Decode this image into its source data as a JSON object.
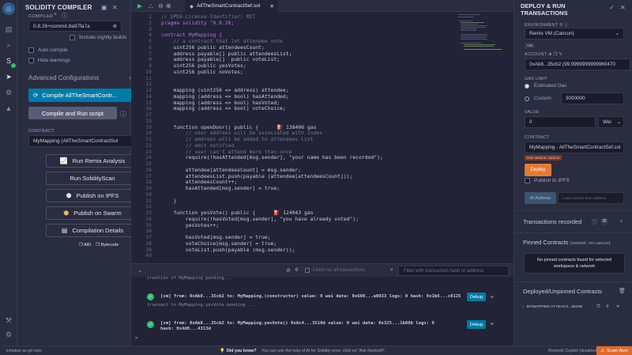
{
  "left_panel": {
    "title": "SOLIDITY COMPILER",
    "compiler_label": "COMPILER",
    "compiler_version": "0.8.26+commit.8a97fa7a",
    "include_nightly": "Include nightly builds",
    "auto_compile": "Auto compile",
    "hide_warnings": "Hide warnings",
    "advanced": "Advanced Configurations",
    "compile_button": "Compile AllTheSmartContr...",
    "compile_run_button": "Compile and Run script",
    "contract_label": "CONTRACT",
    "contract_value": "MyMapping (AllTheSmartContractSol",
    "tools": [
      {
        "label": "Run Remix Analysis"
      },
      {
        "label": "Run SolidityScan"
      },
      {
        "label": "Publish on IPFS"
      },
      {
        "label": "Publish on Swarm"
      },
      {
        "label": "Compilation Details"
      }
    ],
    "abi": "ABI",
    "bytecode": "Bytecode"
  },
  "editor": {
    "tab_name": "AllTheSmartContractSef.sol",
    "lines": [
      {
        "n": "1",
        "t": "// SPDX-License-Identifier: MIT",
        "c": "cm"
      },
      {
        "n": "2",
        "t": "pragma solidity ^0.8.20;",
        "c": "kw"
      },
      {
        "n": "3",
        "t": "",
        "c": ""
      },
      {
        "n": "4",
        "t": "contract MyMapping {",
        "c": "kw"
      },
      {
        "n": "5",
        "t": "    // a contract that let attendee vote",
        "c": "cm"
      },
      {
        "n": "6",
        "t": "    uint256 public attendeesCount;",
        "c": ""
      },
      {
        "n": "7",
        "t": "    address payable[] public attendeesList;",
        "c": ""
      },
      {
        "n": "8",
        "t": "    address payable[]  public voteList;",
        "c": ""
      },
      {
        "n": "9",
        "t": "    uint256 public yesVotes;",
        "c": ""
      },
      {
        "n": "10",
        "t": "    uint256 public noVotes;",
        "c": ""
      },
      {
        "n": "11",
        "t": "",
        "c": ""
      },
      {
        "n": "12",
        "t": "",
        "c": ""
      },
      {
        "n": "13",
        "t": "    mapping (uint256 => address) attendee;",
        "c": ""
      },
      {
        "n": "14",
        "t": "    mapping (address => bool) hasAttended;",
        "c": ""
      },
      {
        "n": "15",
        "t": "    mapping (address => bool) hasVoted;",
        "c": ""
      },
      {
        "n": "16",
        "t": "    mapping (address => bool) voteChoice;",
        "c": ""
      },
      {
        "n": "17",
        "t": "",
        "c": ""
      },
      {
        "n": "18",
        "t": "",
        "c": ""
      },
      {
        "n": "19",
        "t": "    function openDoor() public {      ⛽ 138406 gas",
        "c": ""
      },
      {
        "n": "20",
        "t": "        // user address will be associated with index",
        "c": "cm"
      },
      {
        "n": "21",
        "t": "        // address will be added to attendees list",
        "c": "cm"
      },
      {
        "n": "22",
        "t": "        // emit notified",
        "c": "cm"
      },
      {
        "n": "23",
        "t": "        // user can't attend more than once",
        "c": "cm"
      },
      {
        "n": "24",
        "t": "        require(!hasAttended[msg.sender], \"your name has been recorded\");",
        "c": ""
      },
      {
        "n": "25",
        "t": "",
        "c": ""
      },
      {
        "n": "26",
        "t": "        attendee[attendeesCount] = msg.sender;",
        "c": ""
      },
      {
        "n": "27",
        "t": "        attendeesList.push(payable (attendee[attendeesCount]));",
        "c": ""
      },
      {
        "n": "28",
        "t": "        attendeesCount++;",
        "c": ""
      },
      {
        "n": "29",
        "t": "        hasAttended[msg.sender] = true;",
        "c": ""
      },
      {
        "n": "30",
        "t": "",
        "c": ""
      },
      {
        "n": "31",
        "t": "    }",
        "c": ""
      },
      {
        "n": "32",
        "t": "",
        "c": ""
      },
      {
        "n": "33",
        "t": "    function yesVote() public {      ⛽ 124043 gas",
        "c": ""
      },
      {
        "n": "34",
        "t": "        require(!hasVoted[msg.sender], \"you have already voted\");",
        "c": ""
      },
      {
        "n": "35",
        "t": "        yesVotes++;",
        "c": ""
      },
      {
        "n": "36",
        "t": "",
        "c": ""
      },
      {
        "n": "37",
        "t": "        hasVoted[msg.sender] = true;",
        "c": ""
      },
      {
        "n": "38",
        "t": "        voteChoice[msg.sender] = true;",
        "c": ""
      },
      {
        "n": "39",
        "t": "        voteList.push(payable (msg.sender));",
        "c": ""
      },
      {
        "n": "40",
        "t": "",
        "c": ""
      }
    ]
  },
  "terminal": {
    "count": "0",
    "listen_label": "Listen on all transactions",
    "filter_placeholder": "Filter with transaction hash or address",
    "pending_top": "creation of MyMapping pending...",
    "tx1": "[vm]  from: 0xAb8...35cb2 to: MyMapping.(constructor) value: 0 wei data: 0x608...a0033 logs: 0 hash: 0x1b6...c8125",
    "pending_mid": "transact to MyMapping.yesVote pending ...",
    "tx2_a": "[vm]  from: 0xAb8...35cb2 to: MyMapping.yesVote() 0xAc4...3510d value: 0 wei data: 0x325...1b88b logs: 0",
    "tx2_b": "hash: 0x4d0...4313d",
    "debug": "Debug",
    "prompt": ">"
  },
  "right_panel": {
    "title_line1": "DEPLOY & RUN",
    "title_line2": "TRANSACTIONS",
    "environment_label": "ENVIRONMENT",
    "environment_value": "Remix VM (Cancun)",
    "vm_badge": "VM",
    "account_label": "ACCOUNT",
    "account_value": "0xAb8...35cb2 (99.9999999999960470",
    "gas_label": "GAS LIMIT",
    "estimated_gas": "Estimated Gas",
    "custom": "Custom",
    "custom_value": "3000000",
    "value_label": "VALUE",
    "value_value": "0",
    "value_unit": "Wei",
    "contract_label": "CONTRACT",
    "contract_value": "MyMapping - AllTheSmartContractSef.sol",
    "evm_badge": "evm version: cancun",
    "deploy": "Deploy",
    "publish_ipfs": "Publish to IPFS",
    "at_address": "At Address",
    "at_address_placeholder": "Load contract from Address",
    "tx_recorded": "Transactions recorded",
    "tx_recorded_count": "25",
    "pinned_title": "Pinned Contracts",
    "pinned_sub": "(network: vm-cancun)",
    "pinned_empty_1": "No pinned contracts found for selected",
    "pinned_empty_2": "workspace & network",
    "deployed_title": "Deployed/Unpinned Contracts",
    "deployed_item": "MYMAPPING AT 0XAC4...3510D"
  },
  "status_bar": {
    "left": "initialize as git repo",
    "tip_title": "Did you know?",
    "tip": "You can use the help of AI for Solidity error, click on \"Ask RemixAI\".",
    "copilot": "RemixAI Copilot (disabled)",
    "scam": "Scam Alert"
  },
  "colors": {
    "accent": "#007aa6",
    "deploy": "#e07b39",
    "success": "#2fbf71",
    "background": "#222336",
    "panel": "#2a2c3f"
  }
}
